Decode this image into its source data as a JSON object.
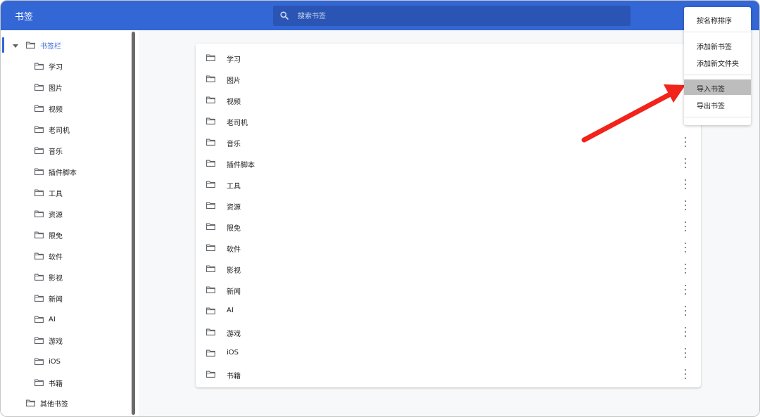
{
  "header": {
    "title": "书签"
  },
  "search": {
    "placeholder": "搜索书签"
  },
  "sidebar": {
    "root_label": "书签栏",
    "children": [
      "学习",
      "图片",
      "视频",
      "老司机",
      "音乐",
      "插件脚本",
      "工具",
      "资源",
      "限免",
      "软件",
      "影视",
      "新闻",
      "AI",
      "游戏",
      "iOS",
      "书籍"
    ],
    "other_label": "其他书签"
  },
  "list": {
    "items": [
      "学习",
      "图片",
      "视频",
      "老司机",
      "音乐",
      "插件脚本",
      "工具",
      "资源",
      "限免",
      "软件",
      "影视",
      "新闻",
      "AI",
      "游戏",
      "iOS",
      "书籍"
    ]
  },
  "menu": {
    "sort_by_name": "按名称排序",
    "add_bookmark": "添加新书签",
    "add_folder": "添加新文件夹",
    "import": "导入书签",
    "export": "导出书签"
  },
  "colors": {
    "accent": "#3367d6",
    "arrow": "#f2231b",
    "highlight": "#bdbdbd"
  }
}
